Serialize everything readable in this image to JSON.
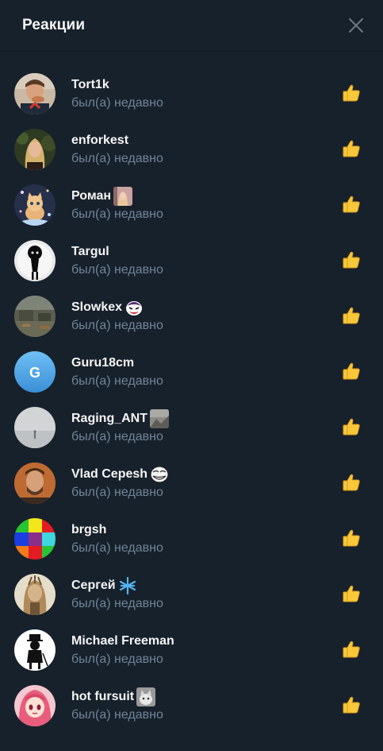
{
  "header": {
    "title": "Реакции"
  },
  "list": [
    {
      "name": "Tort1k",
      "status": "был(а) недавно",
      "avatar_icon": "man-eating-avatar",
      "badge_icon": null,
      "reaction_icon": "thumbs-up-icon"
    },
    {
      "name": "enforkest",
      "status": "был(а) недавно",
      "avatar_icon": "blonde-woman-avatar",
      "badge_icon": null,
      "reaction_icon": "thumbs-up-icon"
    },
    {
      "name": "Роман",
      "status": "был(а) недавно",
      "avatar_icon": "cat-sparkles-avatar",
      "badge_icon": "photo-emoji-icon",
      "reaction_icon": "thumbs-up-icon"
    },
    {
      "name": "Targul",
      "status": "был(а) недавно",
      "avatar_icon": "limbo-boy-avatar",
      "badge_icon": null,
      "reaction_icon": "thumbs-up-icon"
    },
    {
      "name": "Slowkex",
      "status": "был(а) недавно",
      "avatar_icon": "ruins-avatar",
      "badge_icon": "joker-emoji-icon",
      "reaction_icon": "thumbs-up-icon"
    },
    {
      "name": "Guru18cm",
      "status": "был(а) недавно",
      "avatar_letter": "G",
      "avatar_icon": "letter-avatar",
      "badge_icon": null,
      "reaction_icon": "thumbs-up-icon"
    },
    {
      "name": "Raging_ANT",
      "status": "был(а) недавно",
      "avatar_icon": "foggy-figure-avatar",
      "badge_icon": "photo-emoji-icon",
      "reaction_icon": "thumbs-up-icon"
    },
    {
      "name": "Vlad Cepesh",
      "status": "был(а) недавно",
      "avatar_icon": "man-portrait-avatar",
      "badge_icon": "trollface-emoji-icon",
      "reaction_icon": "thumbs-up-icon"
    },
    {
      "name": "brgsh",
      "status": "был(а) недавно",
      "avatar_icon": "color-grid-avatar",
      "badge_icon": null,
      "reaction_icon": "thumbs-up-icon"
    },
    {
      "name": "Сергей",
      "status": "был(а) недавно",
      "avatar_icon": "artistic-face-avatar",
      "badge_icon": "blue-snowflake-emoji-icon",
      "reaction_icon": "thumbs-up-icon"
    },
    {
      "name": "Michael Freeman",
      "status": "был(а) недавно",
      "avatar_icon": "gentleman-silhouette-avatar",
      "badge_icon": null,
      "reaction_icon": "thumbs-up-icon"
    },
    {
      "name": "hot fursuit",
      "status": "был(а) недавно",
      "avatar_icon": "anime-girl-avatar",
      "badge_icon": "cat-photo-emoji-icon",
      "reaction_icon": "thumbs-up-icon"
    }
  ],
  "colors": {
    "background": "#17212b",
    "name_text": "#f5f5f5",
    "status_text": "#708499",
    "letter_avatar": "#4ea4e6"
  }
}
